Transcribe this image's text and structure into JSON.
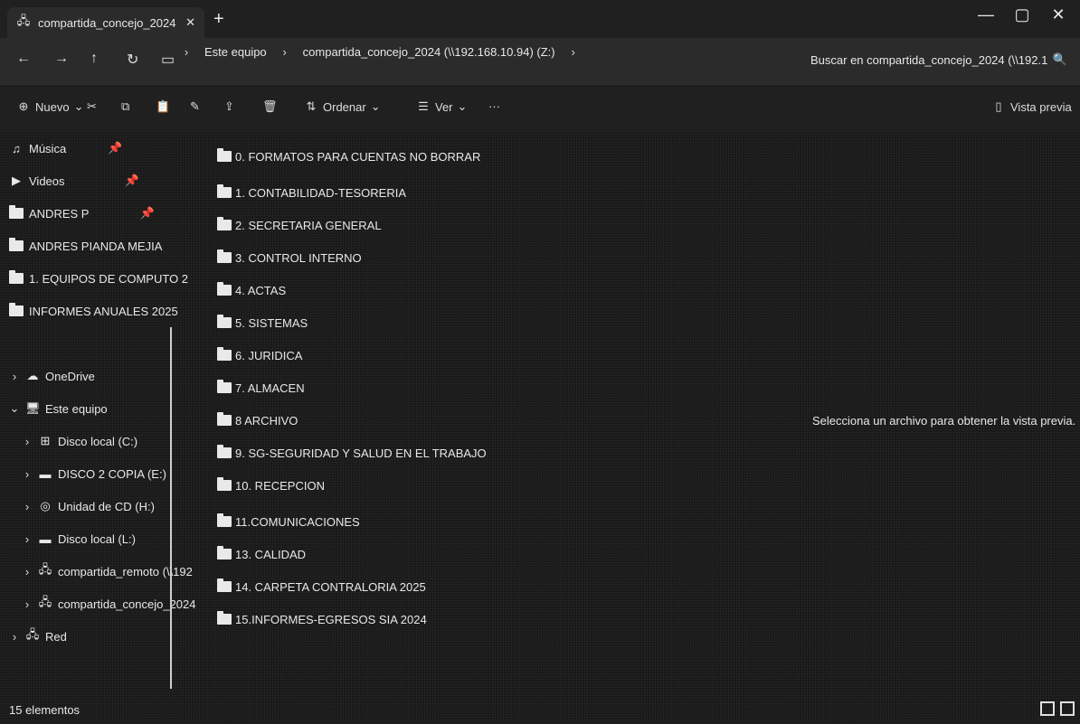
{
  "window": {
    "tab_title": "compartida_concejo_2024 (\\\\",
    "tab_icon": "network-drive-icon",
    "close_glyph": "✕",
    "new_tab_glyph": "+",
    "minimize_glyph": "—",
    "maximize_glyph": "▢",
    "winclose_glyph": "✕"
  },
  "nav": {
    "back": "←",
    "forward": "→",
    "up": "↑",
    "refresh": "↻",
    "breadcrumb": [
      "Este equipo",
      "compartida_concejo_2024 (\\\\192.168.10.94) (Z:)"
    ],
    "sep": "›",
    "search_placeholder": "Buscar en compartida_concejo_2024 (\\\\192.1",
    "search_icon": "🔍"
  },
  "toolbar": {
    "new_label": "Nuevo",
    "sort_label": "Ordenar",
    "view_label": "Ver",
    "more": "···",
    "preview_label": "Vista previa"
  },
  "sidebar": {
    "quick": [
      {
        "label": "Música",
        "pinned": true
      },
      {
        "label": "Videos",
        "pinned": true
      },
      {
        "label": "ANDRES P",
        "pinned": true
      },
      {
        "label": "ANDRES PIANDA MEJIA",
        "pinned": false
      },
      {
        "label": "1. EQUIPOS DE COMPUTO 2",
        "pinned": false
      },
      {
        "label": "INFORMES ANUALES 2025",
        "pinned": false
      }
    ],
    "tree": [
      {
        "label": "OneDrive",
        "chev": "›"
      },
      {
        "label": "Este equipo",
        "chev": "⌄"
      },
      {
        "label": "Disco local (C:)",
        "chev": "›"
      },
      {
        "label": "DISCO 2 COPIA (E:)",
        "chev": "›"
      },
      {
        "label": "Unidad de CD (H:)",
        "chev": "›"
      },
      {
        "label": "Disco local (L:)",
        "chev": "›"
      },
      {
        "label": "compartida_remoto (\\\\192",
        "chev": "›"
      },
      {
        "label": "compartida_concejo_2024",
        "chev": "›"
      },
      {
        "label": "Red",
        "chev": "›"
      }
    ]
  },
  "files": [
    "0. FORMATOS PARA CUENTAS NO BORRAR",
    "1. CONTABILIDAD-TESORERIA",
    "2. SECRETARIA GENERAL",
    "3. CONTROL INTERNO",
    "4. ACTAS",
    "5. SISTEMAS",
    "6. JURIDICA",
    "7. ALMACEN",
    "8 ARCHIVO",
    "9. SG-SEGURIDAD Y SALUD EN EL TRABAJO",
    "10. RECEPCION",
    "11.COMUNICACIONES",
    "13. CALIDAD",
    "14. CARPETA CONTRALORIA 2025",
    "15.INFORMES-EGRESOS SIA 2024"
  ],
  "preview_message": "Selecciona un archivo para obtener la vista previa.",
  "status": {
    "count": "15 elementos"
  }
}
